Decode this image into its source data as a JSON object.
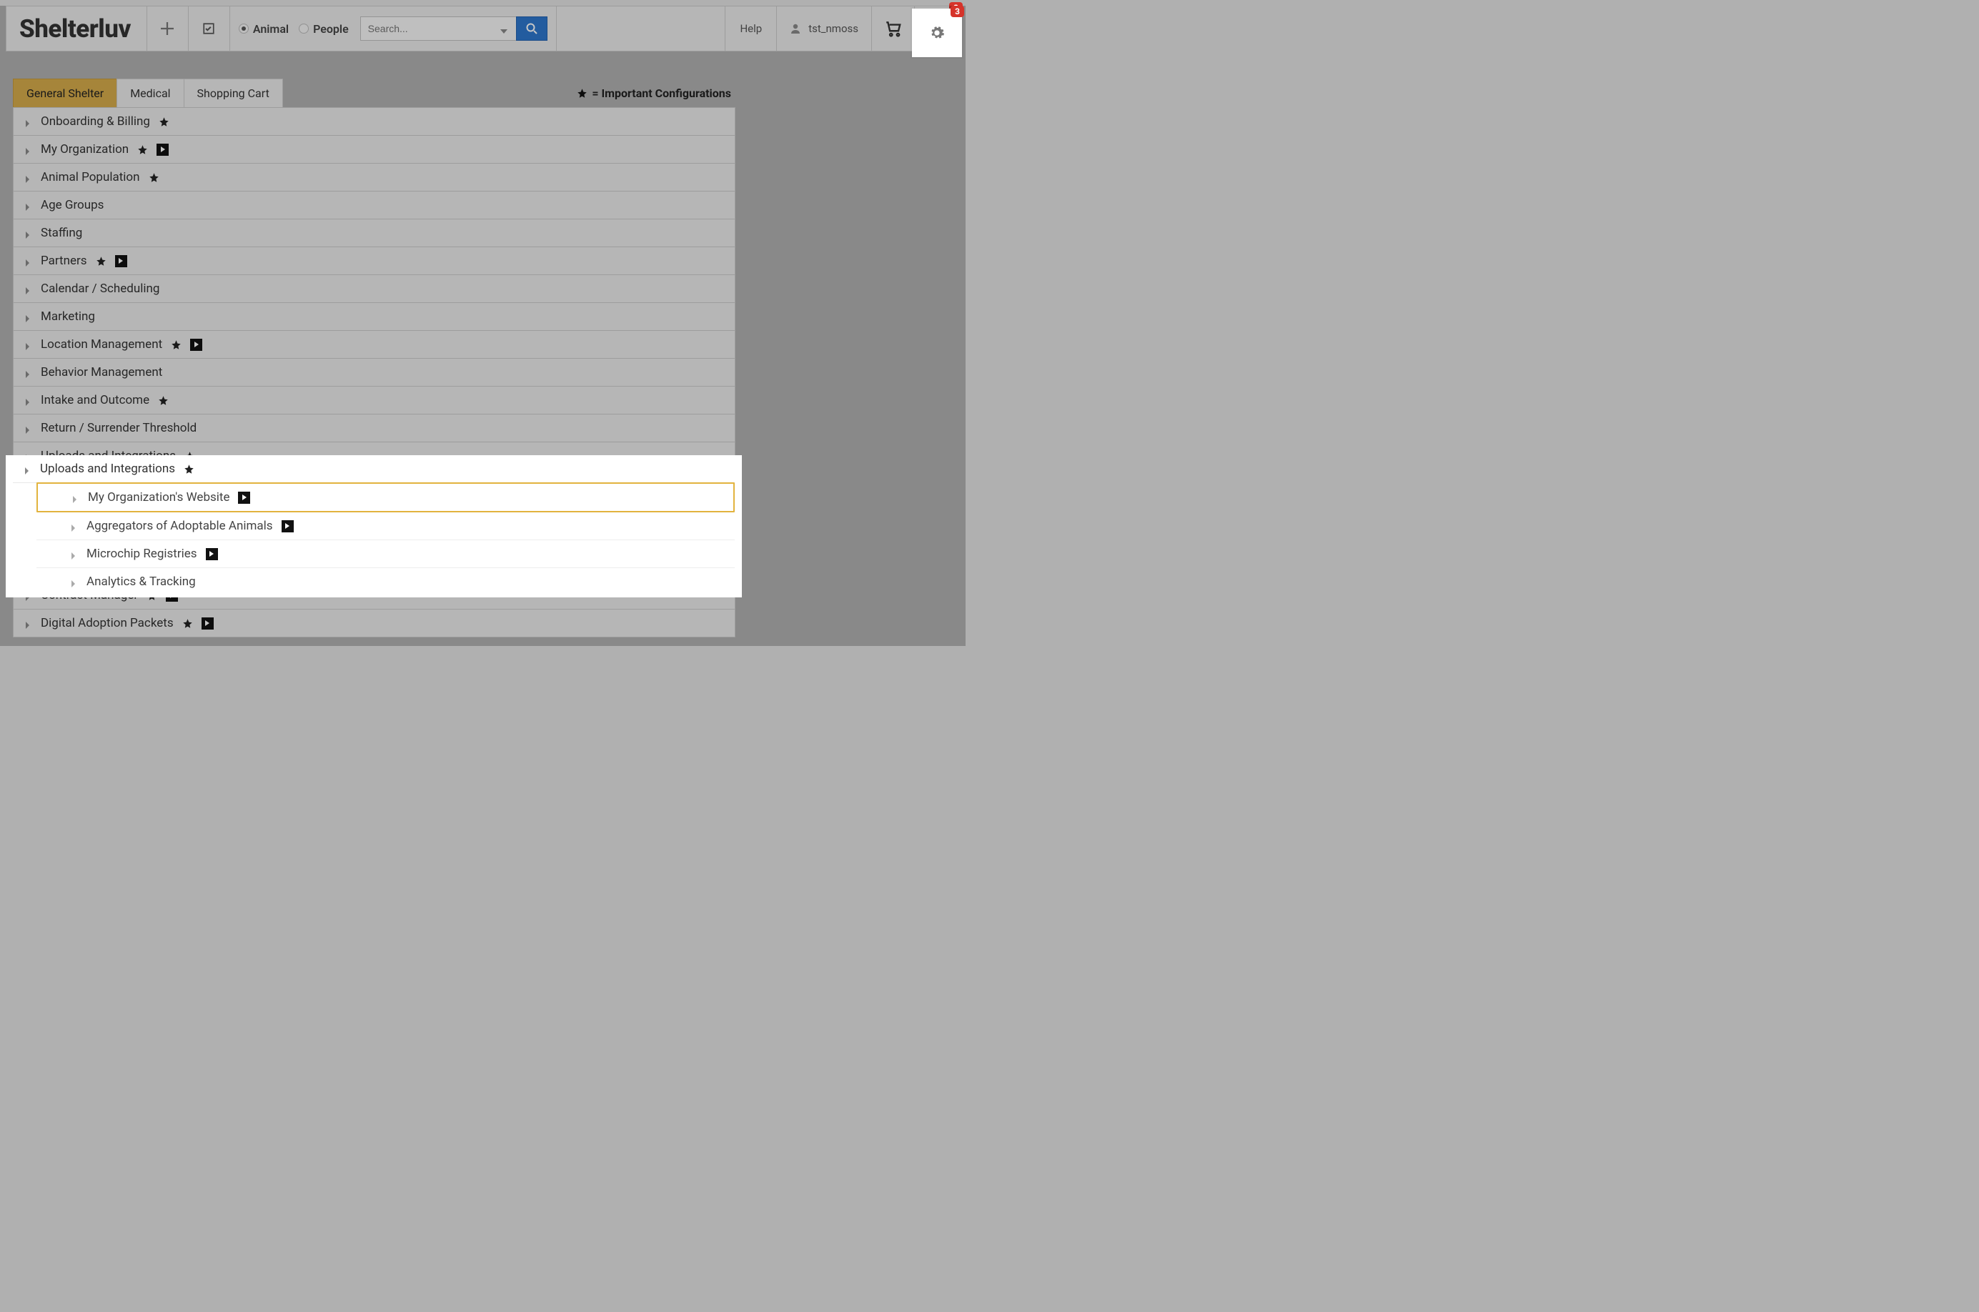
{
  "app": {
    "name": "Shelterluv"
  },
  "header": {
    "search_placeholder": "Search...",
    "radio_animal": "Animal",
    "radio_people": "People",
    "help": "Help",
    "username": "tst_nmoss",
    "gear_badge": "3"
  },
  "tabs": {
    "general": "General Shelter",
    "medical": "Medical",
    "cart": "Shopping Cart",
    "active": "general"
  },
  "legend_text": " = Important Configurations",
  "rows": [
    {
      "label": "Onboarding & Billing",
      "star": true,
      "video": false
    },
    {
      "label": "My Organization",
      "star": true,
      "video": true
    },
    {
      "label": "Animal Population",
      "star": true,
      "video": false
    },
    {
      "label": "Age Groups",
      "star": false,
      "video": false
    },
    {
      "label": "Staffing",
      "star": false,
      "video": false
    },
    {
      "label": "Partners",
      "star": true,
      "video": true
    },
    {
      "label": "Calendar / Scheduling",
      "star": false,
      "video": false
    },
    {
      "label": "Marketing",
      "star": false,
      "video": false
    },
    {
      "label": "Location Management",
      "star": true,
      "video": true
    },
    {
      "label": "Behavior Management",
      "star": false,
      "video": false
    },
    {
      "label": "Intake and Outcome",
      "star": true,
      "video": false
    },
    {
      "label": "Return / Surrender Threshold",
      "star": false,
      "video": false
    }
  ],
  "uploads": {
    "label": "Uploads and Integrations",
    "children": [
      {
        "label": "My Organization's Website",
        "video": true,
        "selected": true
      },
      {
        "label": "Aggregators of Adoptable Animals",
        "video": true,
        "selected": false
      },
      {
        "label": "Microchip Registries",
        "video": true,
        "selected": false
      },
      {
        "label": "Analytics & Tracking",
        "video": false,
        "selected": false
      }
    ]
  },
  "rows_after": [
    {
      "label": "Contract Manager",
      "star": true,
      "video": true
    },
    {
      "label": "Digital Adoption Packets",
      "star": true,
      "video": true
    }
  ]
}
